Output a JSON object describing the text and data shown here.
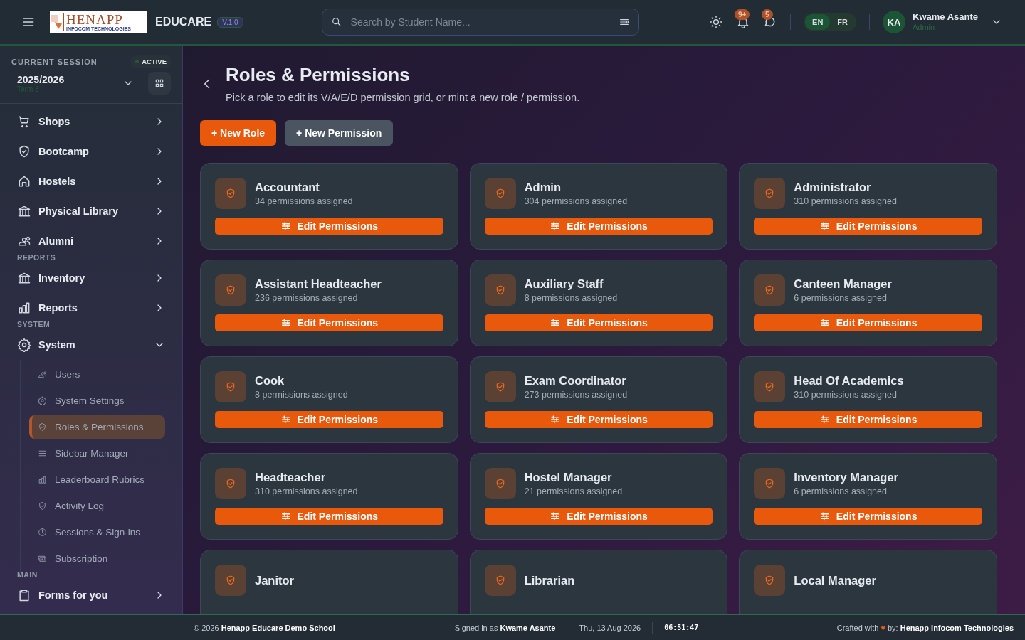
{
  "header": {
    "logo_title": "HENAPP",
    "logo_subtitle": "INFOCOM TECHNOLOGIES",
    "brand": "EDUCARE",
    "version": "V.1.0",
    "search": {
      "placeholder": "Search by Student Name..."
    },
    "notifications_badge": "9+",
    "messages_badge": "5",
    "languages": [
      {
        "label": "EN",
        "selected": true
      },
      {
        "label": "FR",
        "selected": false
      }
    ],
    "user": {
      "initials": "KA",
      "name": "Kwame Asante",
      "role": "Admin"
    }
  },
  "sidebar": {
    "session": {
      "label": "CURRENT SESSION",
      "status": "ACTIVE",
      "year": "2025/2026",
      "term": "Term 3"
    },
    "items": [
      {
        "kind": "item",
        "label": "Shops",
        "expanded": false
      },
      {
        "kind": "item",
        "label": "Bootcamp",
        "expanded": false
      },
      {
        "kind": "item",
        "label": "Hostels",
        "expanded": false
      },
      {
        "kind": "item",
        "label": "Physical Library",
        "expanded": false
      },
      {
        "kind": "item",
        "label": "Alumni",
        "expanded": false
      },
      {
        "kind": "section",
        "label": "REPORTS"
      },
      {
        "kind": "item",
        "label": "Inventory",
        "expanded": false
      },
      {
        "kind": "item",
        "label": "Reports",
        "expanded": false
      },
      {
        "kind": "section",
        "label": "SYSTEM"
      },
      {
        "kind": "item",
        "label": "System",
        "expanded": true,
        "children": [
          {
            "label": "Users",
            "selected": false
          },
          {
            "label": "System Settings",
            "selected": false
          },
          {
            "label": "Roles & Permissions",
            "selected": true
          },
          {
            "label": "Sidebar Manager",
            "selected": false
          },
          {
            "label": "Leaderboard Rubrics",
            "selected": false
          },
          {
            "label": "Activity Log",
            "selected": false
          },
          {
            "label": "Sessions & Sign-ins",
            "selected": false
          },
          {
            "label": "Subscription",
            "selected": false
          }
        ]
      },
      {
        "kind": "section",
        "label": "MAIN"
      },
      {
        "kind": "item",
        "label": "Forms for you",
        "expanded": false
      }
    ]
  },
  "page": {
    "title": "Roles & Permissions",
    "subtitle": "Pick a role to edit its V/A/E/D permission grid, or mint a new role / permission.",
    "actions": [
      {
        "label": "+ New Role",
        "kind": "primary"
      },
      {
        "label": "+ New Permission",
        "kind": "secondary"
      }
    ]
  },
  "roles": [
    {
      "name": "Accountant",
      "count": "34 permissions assigned",
      "button": "Edit Permissions"
    },
    {
      "name": "Admin",
      "count": "304 permissions assigned",
      "button": "Edit Permissions"
    },
    {
      "name": "Administrator",
      "count": "310 permissions assigned",
      "button": "Edit Permissions"
    },
    {
      "name": "Assistant Headteacher",
      "count": "236 permissions assigned",
      "button": "Edit Permissions"
    },
    {
      "name": "Auxiliary Staff",
      "count": "8 permissions assigned",
      "button": "Edit Permissions"
    },
    {
      "name": "Canteen Manager",
      "count": "6 permissions assigned",
      "button": "Edit Permissions"
    },
    {
      "name": "Cook",
      "count": "8 permissions assigned",
      "button": "Edit Permissions"
    },
    {
      "name": "Exam Coordinator",
      "count": "273 permissions assigned",
      "button": "Edit Permissions"
    },
    {
      "name": "Head Of Academics",
      "count": "310 permissions assigned",
      "button": "Edit Permissions"
    },
    {
      "name": "Headteacher",
      "count": "310 permissions assigned",
      "button": "Edit Permissions"
    },
    {
      "name": "Hostel Manager",
      "count": "21 permissions assigned",
      "button": "Edit Permissions"
    },
    {
      "name": "Inventory Manager",
      "count": "6 permissions assigned",
      "button": "Edit Permissions"
    },
    {
      "name": "Janitor"
    },
    {
      "name": "Librarian"
    },
    {
      "name": "Local Manager"
    }
  ],
  "footer": {
    "copyright": "© 2026 **Henapp Educare Demo School**",
    "signed_in": "Signed in as **Kwame Asante**",
    "date": "Thu, 13 Aug 2026",
    "time": "06:51:47",
    "credit_prefix": "Crafted with",
    "heart": "♥",
    "credit": "by: **Henapp Infocom Technologies**"
  }
}
